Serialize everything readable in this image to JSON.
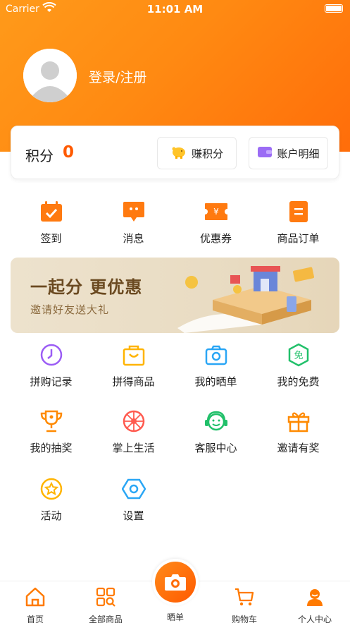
{
  "status_bar": {
    "carrier": "Carrier",
    "time": "11:01 AM"
  },
  "profile": {
    "login_label": "登录/注册"
  },
  "points": {
    "label": "积分",
    "value": "0",
    "earn_label": "赚积分",
    "detail_label": "账户明细"
  },
  "quick_actions": [
    {
      "label": "签到",
      "icon": "calendar-check-icon"
    },
    {
      "label": "消息",
      "icon": "chat-bubble-icon"
    },
    {
      "label": "优惠券",
      "icon": "coupon-icon"
    },
    {
      "label": "商品订单",
      "icon": "order-list-icon"
    }
  ],
  "banner": {
    "title": "一起分 更优惠",
    "subtitle": "邀请好友送大礼"
  },
  "services": [
    {
      "label": "拼购记录",
      "icon": "clock-icon",
      "color": "#9b5cf5"
    },
    {
      "label": "拼得商品",
      "icon": "bag-icon",
      "color": "#ffb400"
    },
    {
      "label": "我的晒单",
      "icon": "camera-icon",
      "color": "#2aa6f5"
    },
    {
      "label": "我的免费",
      "icon": "free-badge-icon",
      "color": "#21c06a"
    },
    {
      "label": "我的抽奖",
      "icon": "trophy-icon",
      "color": "#ff8a00"
    },
    {
      "label": "掌上生活",
      "icon": "wheel-icon",
      "color": "#ff5a4f"
    },
    {
      "label": "客服中心",
      "icon": "headset-icon",
      "color": "#21c06a"
    },
    {
      "label": "邀请有奖",
      "icon": "gift-icon",
      "color": "#ff8a00"
    },
    {
      "label": "活动",
      "icon": "star-badge-icon",
      "color": "#ffb400"
    },
    {
      "label": "设置",
      "icon": "hex-gear-icon",
      "color": "#2aa6f5"
    }
  ],
  "tabbar": {
    "home": "首页",
    "all_products": "全部商品",
    "show": "晒单",
    "cart": "购物车",
    "profile": "个人中心"
  },
  "colors": {
    "accent": "#ff6d0a",
    "points_value": "#ff5a00",
    "tab_active": "#ff7a00"
  }
}
